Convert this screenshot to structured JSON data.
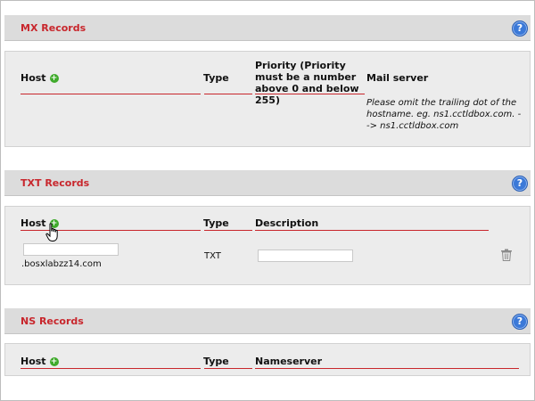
{
  "mx": {
    "title": "MX Records",
    "columns": {
      "host": "Host",
      "type": "Type",
      "priority": "Priority (Priority must be a number above 0 and below 255)",
      "mail_server": "Mail server"
    },
    "note": "Please omit the trailing dot of the hostname. eg. ns1.cctldbox.com. --> ns1.cctldbox.com"
  },
  "txt": {
    "title": "TXT Records",
    "columns": {
      "host": "Host",
      "type": "Type",
      "description": "Description"
    },
    "row": {
      "host_value": "",
      "domain_suffix": ".bosxlabzz14.com",
      "type": "TXT",
      "description_value": ""
    }
  },
  "ns": {
    "title": "NS Records",
    "columns": {
      "host": "Host",
      "type": "Type",
      "nameserver": "Nameserver"
    }
  },
  "icons": {
    "help": "help-icon",
    "add": "add-icon",
    "delete": "trash-icon",
    "cursor": "hand-pointer-icon"
  },
  "colors": {
    "accent": "#c8262c",
    "header_bg": "#dcdcdc",
    "panel_bg": "#ececec",
    "add_green": "#3faa2b",
    "help_blue": "#3b79d8"
  }
}
